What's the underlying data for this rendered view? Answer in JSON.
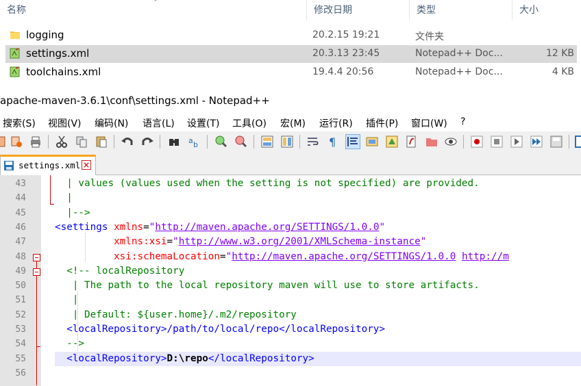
{
  "explorer": {
    "columns": {
      "name": "名称",
      "modified": "修改日期",
      "type": "类型",
      "size": "大小"
    },
    "files": [
      {
        "name": "logging",
        "modified": "20.2.15 19:21",
        "type": "文件夹",
        "size": "",
        "icon": "folder-icon"
      },
      {
        "name": "settings.xml",
        "modified": "20.3.13 23:45",
        "type": "Notepad++ Doc...",
        "size": "12 KB",
        "icon": "xml-file-icon",
        "selected": true
      },
      {
        "name": "toolchains.xml",
        "modified": "19.4.4 20:56",
        "type": "Notepad++ Doc...",
        "size": "4 KB",
        "icon": "xml-file-icon"
      }
    ]
  },
  "npp": {
    "title": "apache-maven-3.6.1\\conf\\settings.xml - Notepad++",
    "menu": [
      "搜索(S)",
      "视图(V)",
      "编码(N)",
      "语言(L)",
      "设置(T)",
      "工具(O)",
      "宏(M)",
      "运行(R)",
      "插件(P)",
      "窗口(W)",
      "?"
    ],
    "tab": {
      "label": "settings.xml"
    },
    "lines": [
      {
        "num": "43",
        "parts": [
          [
            "c-cm",
            "  | values (values used when the setting is not specified) are provided."
          ]
        ]
      },
      {
        "num": "44",
        "parts": [
          [
            "c-cm",
            "  |"
          ]
        ]
      },
      {
        "num": "45",
        "parts": [
          [
            "c-cm",
            "  |-->"
          ]
        ]
      },
      {
        "num": "46",
        "parts": [
          [
            "c-tag",
            "<settings "
          ],
          [
            "c-attr",
            "xmlns"
          ],
          [
            "c-eq",
            "="
          ],
          [
            "c-val",
            "\""
          ],
          [
            "c-url",
            "http://maven.apache.org/SETTINGS/1.0.0"
          ],
          [
            "c-val",
            "\""
          ]
        ]
      },
      {
        "num": "47",
        "parts": [
          [
            "c-attr",
            "          xmlns:xsi"
          ],
          [
            "c-eq",
            "="
          ],
          [
            "c-val",
            "\""
          ],
          [
            "c-url",
            "http://www.w3.org/2001/XMLSchema-instance"
          ],
          [
            "c-val",
            "\""
          ]
        ]
      },
      {
        "num": "48",
        "parts": [
          [
            "c-attr",
            "          xsi:schemaLocation"
          ],
          [
            "c-eq",
            "="
          ],
          [
            "c-val",
            "\""
          ],
          [
            "c-url",
            "http://maven.apache.org/SETTINGS/1.0.0"
          ],
          [
            "c-val",
            " "
          ],
          [
            "c-url",
            "http://m"
          ]
        ]
      },
      {
        "num": "49",
        "parts": [
          [
            "c-cm",
            "  <!-- localRepository"
          ]
        ]
      },
      {
        "num": "50",
        "parts": [
          [
            "c-cm",
            "   | The path to the local repository maven will use to store artifacts."
          ]
        ]
      },
      {
        "num": "51",
        "parts": [
          [
            "c-cm",
            "   |"
          ]
        ]
      },
      {
        "num": "52",
        "parts": [
          [
            "c-cm",
            "   | Default: ${user.home}/.m2/repository"
          ]
        ]
      },
      {
        "num": "53",
        "parts": [
          [
            "c-tag",
            "  <localRepository>/path/to/local/repo</localRepository>"
          ]
        ]
      },
      {
        "num": "54",
        "parts": [
          [
            "c-cm",
            "  -->"
          ]
        ]
      },
      {
        "num": "55",
        "parts": [
          [
            "c-tag",
            "  <localRepository>"
          ],
          [
            "c-txt",
            "D:\\repo"
          ],
          [
            "c-tag",
            "</localRepository>"
          ]
        ],
        "current": true
      },
      {
        "num": "56",
        "parts": []
      }
    ]
  }
}
